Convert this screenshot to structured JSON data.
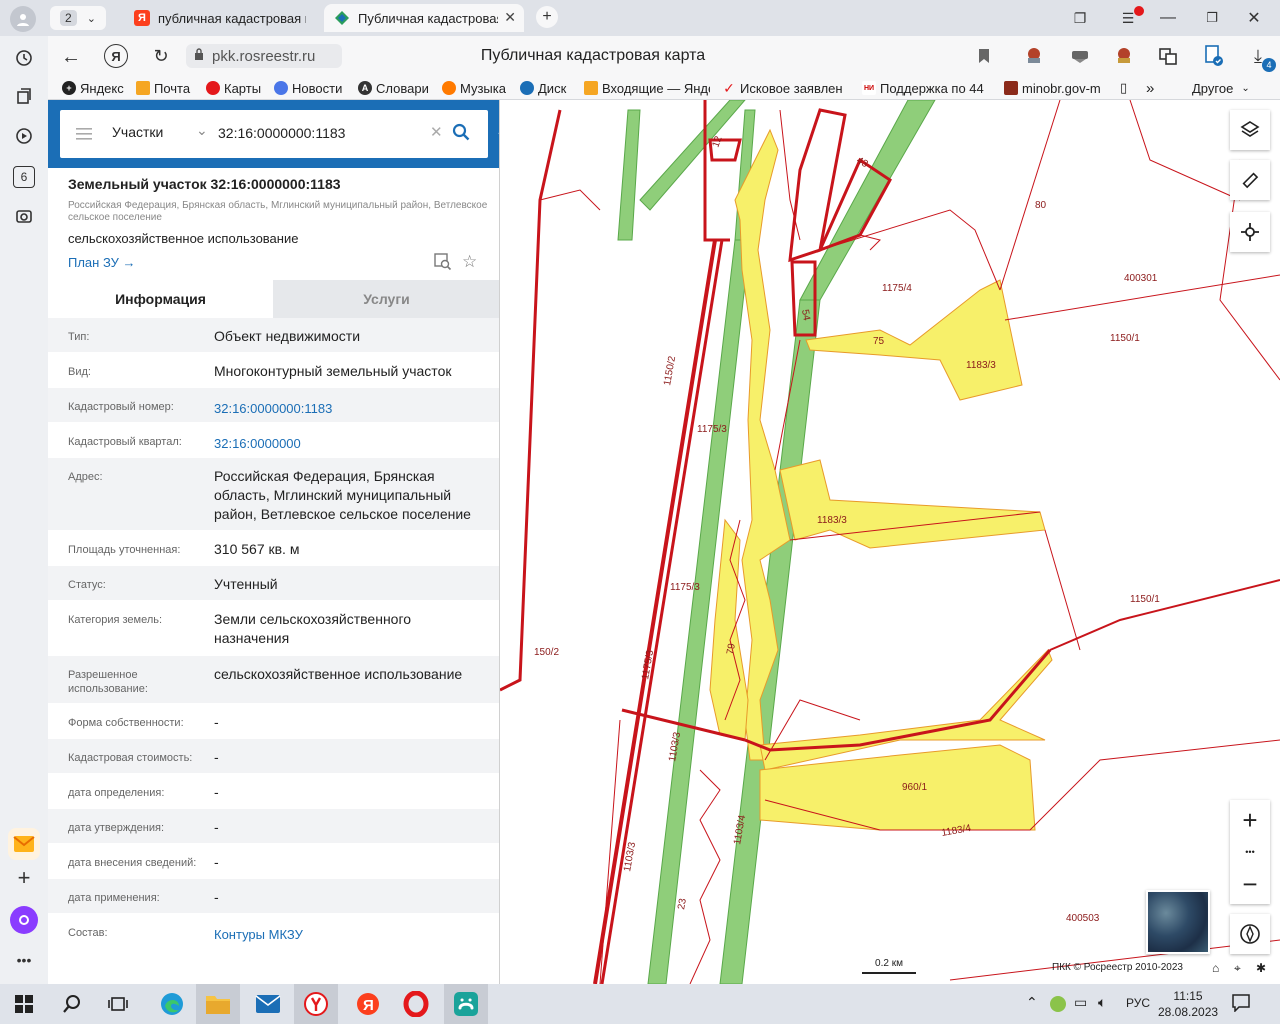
{
  "browser": {
    "tab_count": "2",
    "tabs": [
      {
        "title": "публичная кадастровая карта",
        "active": false
      },
      {
        "title": "Публичная кадастровая карта",
        "active": true
      }
    ],
    "address": "pkk.rosreestr.ru",
    "page_title": "Публичная кадастровая карта",
    "side_counter": "6",
    "download_badge": "4",
    "bookmarks": [
      "Яндекс",
      "Почта",
      "Карты",
      "Новости",
      "Словари",
      "Музыка",
      "Диск",
      "Входящие — Янде",
      "Исковое заявлен",
      "Поддержка по 44",
      "minobr.gov-m"
    ],
    "bookmarks_more": "»",
    "bookmarks_other": "Другое"
  },
  "panel": {
    "search_mode": "Участки",
    "search_value": "32:16:0000000:1183",
    "title": "Земельный участок 32:16:0000000:1183",
    "address_short": "Российская Федерация, Брянская область, Мглинский муниципальный район, Ветлевское сельское поселение",
    "usage_short": "сельскохозяйственное использование",
    "plan_link": "План ЗУ →",
    "tabs": [
      "Информация",
      "Услуги"
    ],
    "rows": [
      {
        "label": "Тип:",
        "value": "Объект недвижимости"
      },
      {
        "label": "Вид:",
        "value": "Многоконтурный земельный участок"
      },
      {
        "label": "Кадастровый номер:",
        "value": "32:16:0000000:1183"
      },
      {
        "label": "Кадастровый квартал:",
        "value": "32:16:0000000"
      },
      {
        "label": "Адрес:",
        "value": "Российская Федерация, Брянская область, Мглинский муниципальный район, Ветлевское сельское поселение"
      },
      {
        "label": "Площадь уточненная:",
        "value": "310 567 кв. м"
      },
      {
        "label": "Статус:",
        "value": "Учтенный"
      },
      {
        "label": "Категория земель:",
        "value": "Земли сельскохозяйственного назначения"
      },
      {
        "label": "Разрешенное использование:",
        "value": "сельскохозяйственное использование"
      },
      {
        "label": "Форма собственности:",
        "value": "-"
      },
      {
        "label": "Кадастровая стоимость:",
        "value": "-"
      },
      {
        "label": "дата определения:",
        "value": "-"
      },
      {
        "label": "дата утверждения:",
        "value": "-"
      },
      {
        "label": "дата внесения сведений:",
        "value": "-"
      },
      {
        "label": "дата применения:",
        "value": "-"
      },
      {
        "label": "Состав:",
        "value": "Контуры МКЗУ"
      }
    ]
  },
  "map": {
    "labels": [
      "12",
      "43",
      "80",
      "400301",
      "1175/4",
      "54",
      "75",
      "1183/3",
      "1150/1",
      "1150/2",
      "1175/3",
      "1183/3",
      "1175/3",
      "1150/1",
      "150/2",
      "1175/3",
      "79",
      "1103/3",
      "960/1",
      "1103/4",
      "1183/4",
      "1103/3",
      "23",
      "400503"
    ],
    "scale": "0.2 км",
    "copyright": "ПКК © Росреестр 2010-2023",
    "zoom_in": "+",
    "zoom_more": "•••",
    "zoom_out": "−"
  },
  "taskbar": {
    "lang": "РУС",
    "time": "11:15",
    "date": "28.08.2023"
  }
}
